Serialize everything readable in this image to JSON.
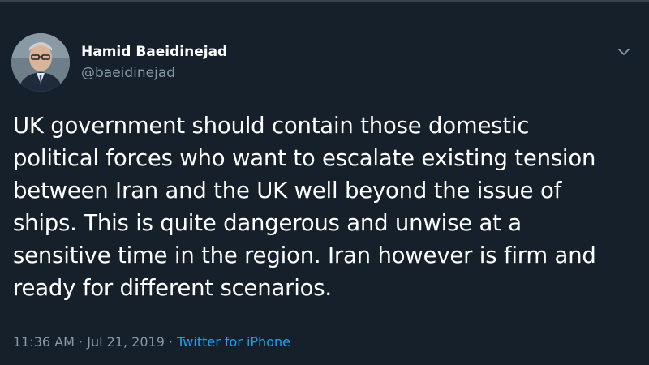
{
  "author": {
    "display_name": "Hamid Baeidinejad",
    "handle": "@baeidinejad"
  },
  "tweet": {
    "text": "UK government should contain those domestic\npolitical forces who want to escalate existing tension\nbetween Iran and the UK well beyond the issue of\nships. This is quite dangerous and unwise at a\nsensitive time in the region. Iran however is firm and\nready for different scenarios.",
    "time": "11:36 AM",
    "separator": "·",
    "date": "Jul 21, 2019",
    "source": "Twitter for iPhone"
  },
  "icons": {
    "caret": "chevron-down-icon"
  },
  "colors": {
    "background": "#15202b",
    "text": "#ffffff",
    "secondary_text": "#8899a6",
    "link": "#1da1f2"
  }
}
